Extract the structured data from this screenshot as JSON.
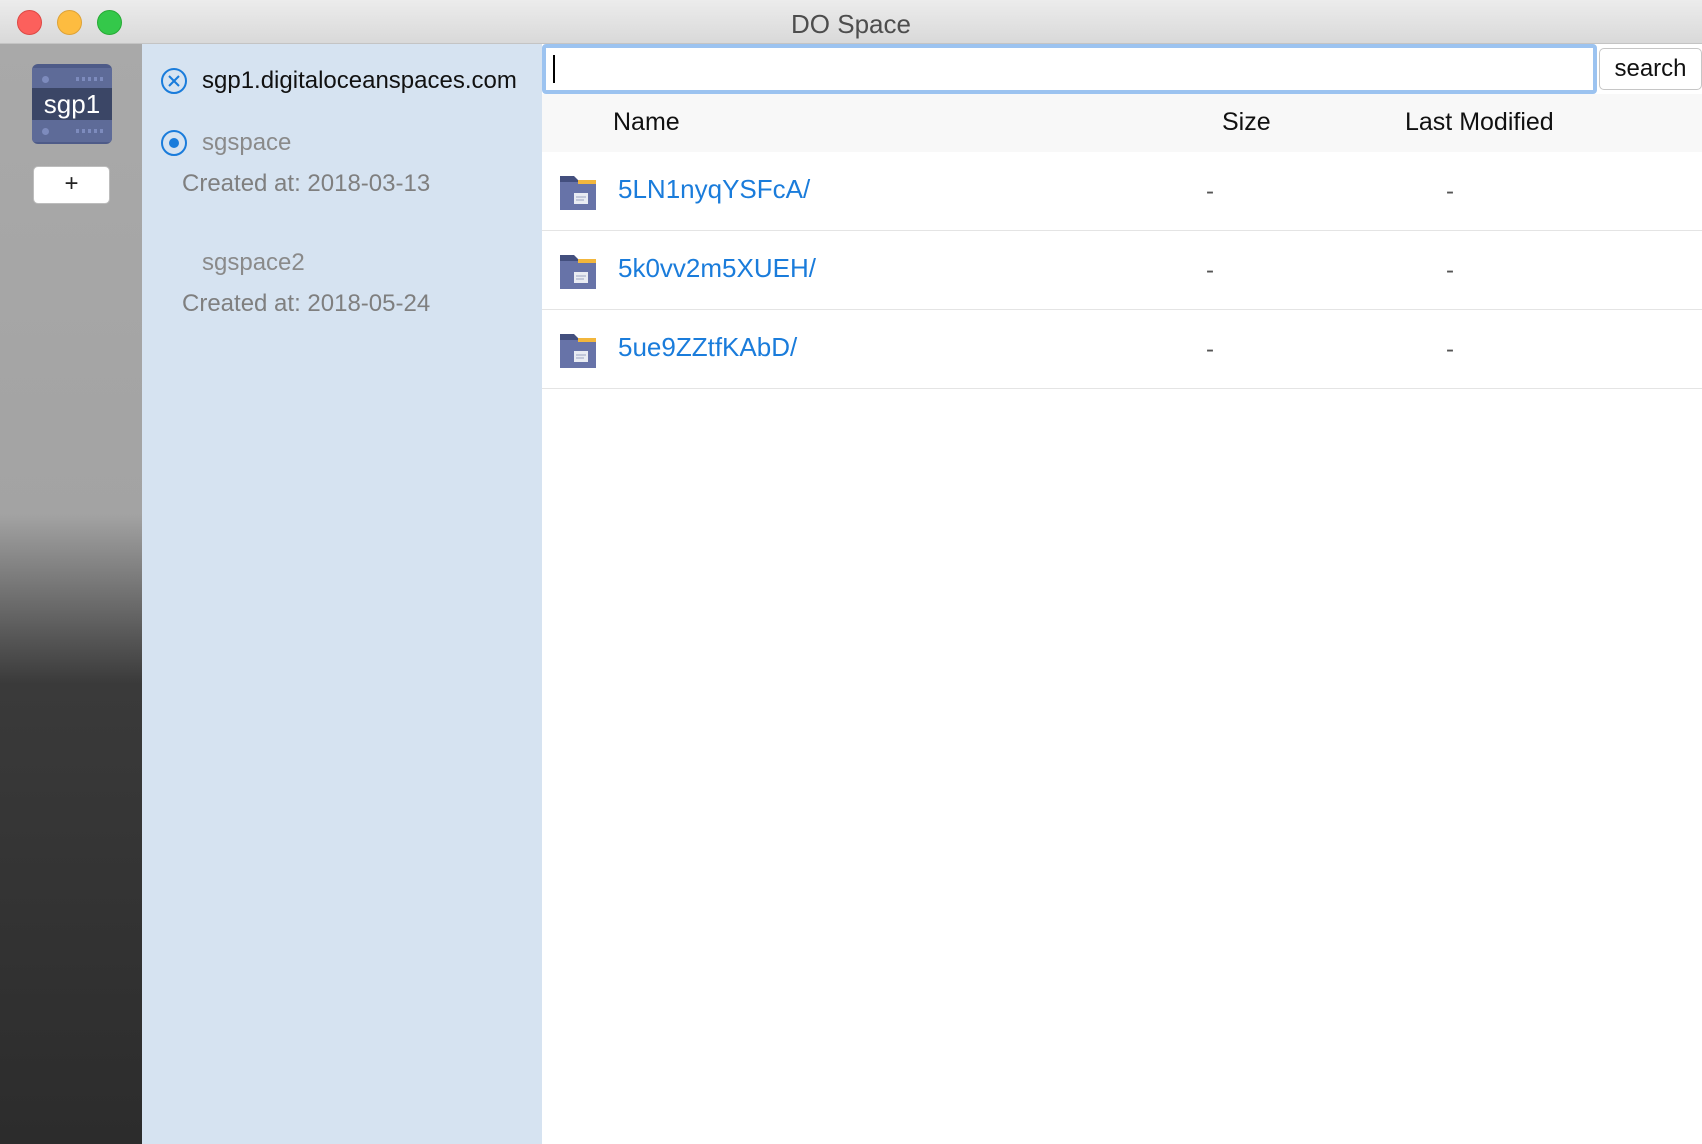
{
  "window": {
    "title": "DO Space"
  },
  "servers": {
    "items": [
      {
        "label": "sgp1"
      }
    ],
    "add_label": "+"
  },
  "spaces_panel": {
    "endpoint": "sgp1.digitaloceanspaces.com",
    "spaces": [
      {
        "name": "sgspace",
        "created": "Created at: 2018-03-13",
        "selected": true
      },
      {
        "name": "sgspace2",
        "created": "Created at: 2018-05-24",
        "selected": false
      }
    ]
  },
  "search": {
    "value": "",
    "placeholder": "",
    "button_label": "search"
  },
  "table": {
    "columns": [
      "Name",
      "Size",
      "Last Modified"
    ],
    "rows": [
      {
        "name": "5LN1nyqYSFcA/",
        "size": "-",
        "modified": "-"
      },
      {
        "name": "5k0vv2m5XUEH/",
        "size": "-",
        "modified": "-"
      },
      {
        "name": "5ue9ZZtfKAbD/",
        "size": "-",
        "modified": "-"
      }
    ]
  },
  "colors": {
    "accent": "#1a7cdb",
    "panel_bg": "#d6e3f1",
    "focus_ring": "#9cc3f0"
  }
}
